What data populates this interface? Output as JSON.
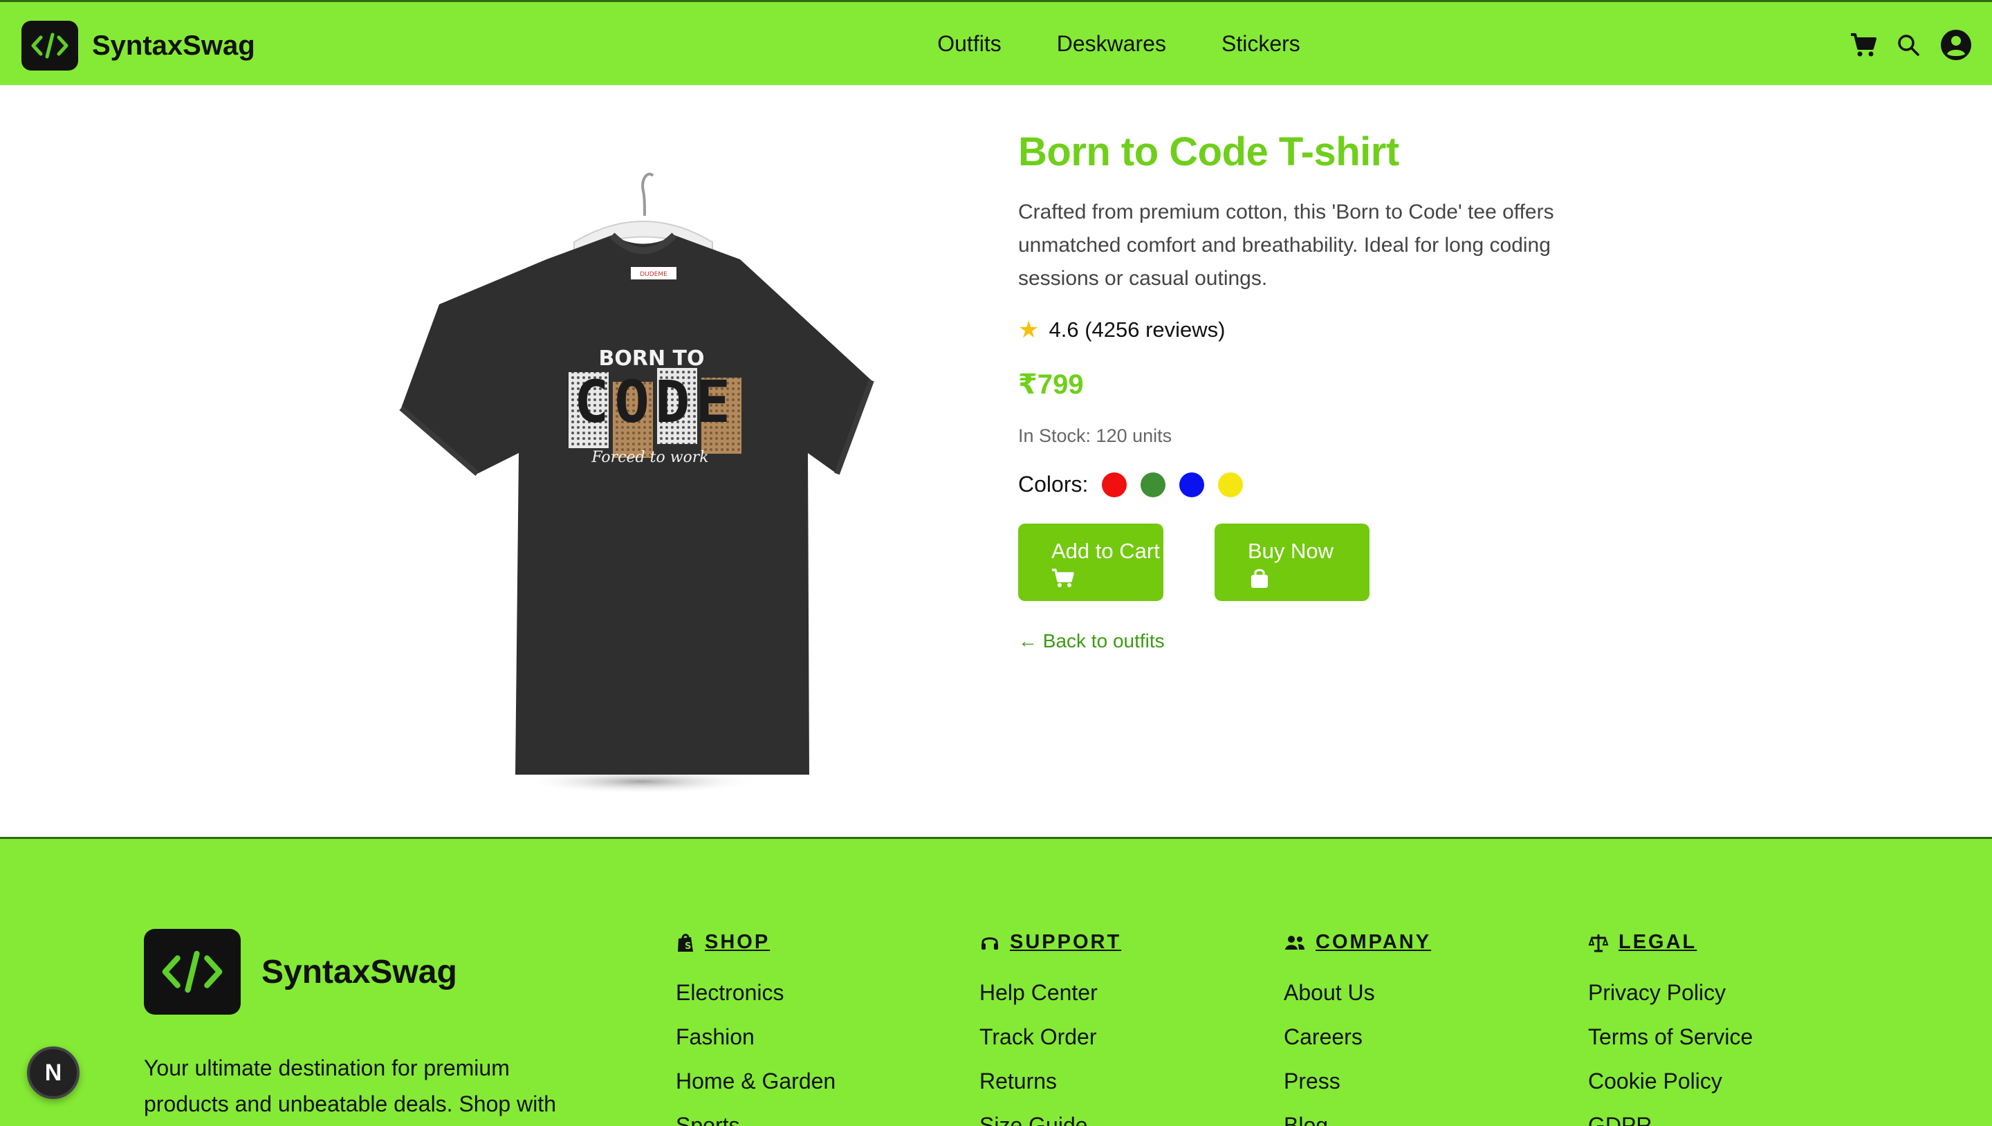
{
  "brand": {
    "name": "SyntaxSwag"
  },
  "nav": {
    "items": [
      "Outfits",
      "Deskwares",
      "Stickers"
    ]
  },
  "header_icons": [
    "cart-icon",
    "search-icon",
    "user-icon"
  ],
  "product": {
    "title": "Born to Code T-shirt",
    "description": "Crafted from premium cotton, this 'Born to Code' tee offers unmatched comfort and breathability. Ideal for long coding sessions or casual outings.",
    "rating": "4.6 (4256 reviews)",
    "price": "₹799",
    "stock": "In Stock: 120 units",
    "colors_label": "Colors:",
    "colors": [
      "#f01010",
      "#3f8f35",
      "#0a12f0",
      "#f5e612"
    ],
    "add_to_cart": "Add to Cart",
    "buy_now": "Buy Now",
    "back_link": "← Back to outfits",
    "image": {
      "line1": "BORN TO",
      "code": "CODE",
      "tagline": "Forced to work",
      "label": "DUDEME"
    }
  },
  "footer": {
    "brand": "SyntaxSwag",
    "description": "Your ultimate destination for premium products and unbeatable deals. Shop with",
    "columns": [
      {
        "heading": "SHOP",
        "links": [
          "Electronics",
          "Fashion",
          "Home & Garden",
          "Sports"
        ]
      },
      {
        "heading": "SUPPORT",
        "links": [
          "Help Center",
          "Track Order",
          "Returns",
          "Size Guide"
        ]
      },
      {
        "heading": "COMPANY",
        "links": [
          "About Us",
          "Careers",
          "Press",
          "Blog"
        ]
      },
      {
        "heading": "LEGAL",
        "links": [
          "Privacy Policy",
          "Terms of Service",
          "Cookie Policy",
          "GDPR"
        ]
      }
    ]
  },
  "badge": {
    "letter": "N"
  },
  "colors": {
    "accent": "#84ea35",
    "title_green": "#6fcf1a",
    "button_green": "#72c90e"
  }
}
